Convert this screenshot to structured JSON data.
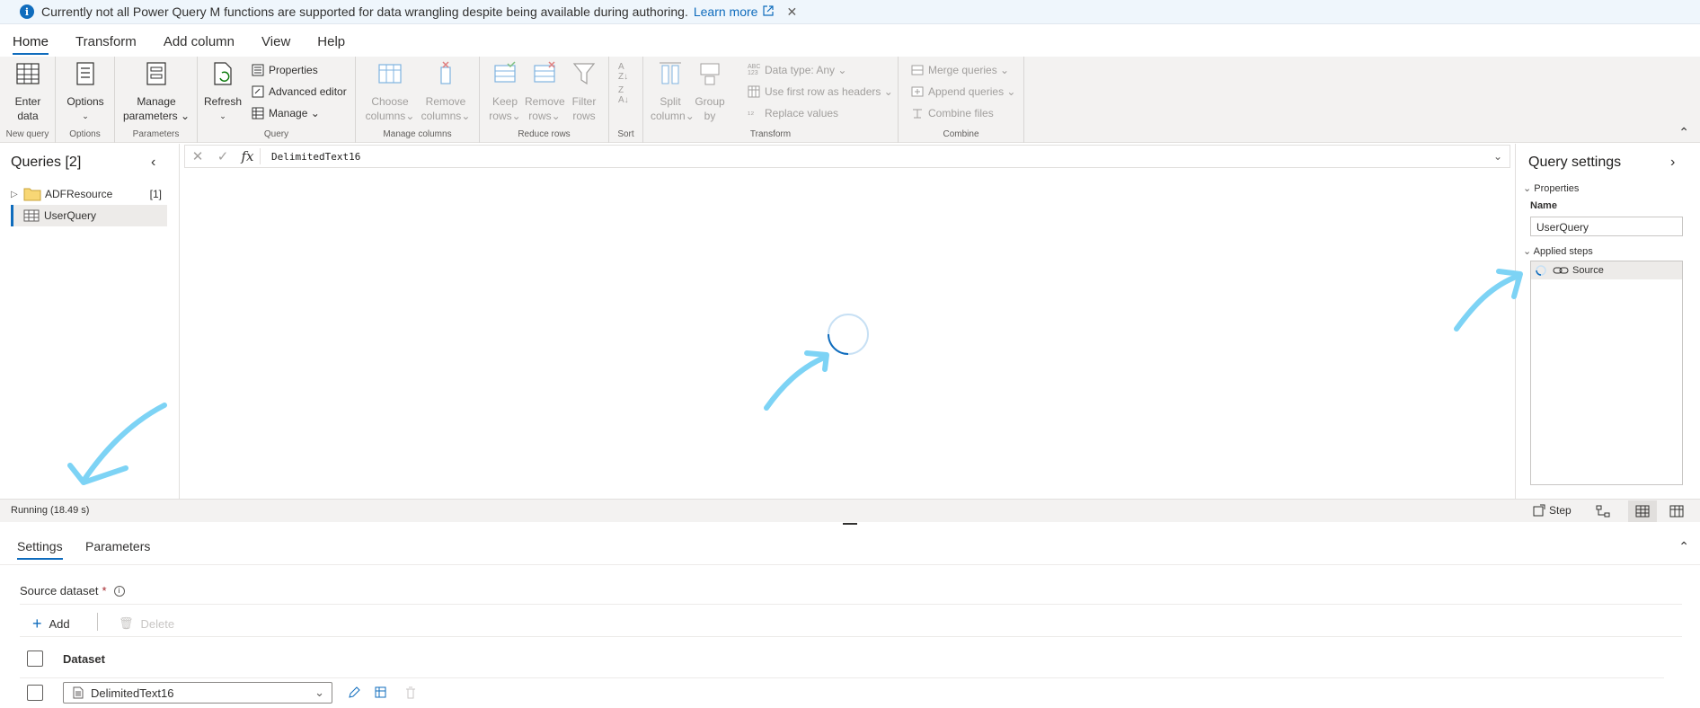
{
  "infobar": {
    "message": "Currently not all Power Query M functions are supported for data wrangling despite being available during authoring.",
    "link": "Learn more"
  },
  "tabs": [
    "Home",
    "Transform",
    "Add column",
    "View",
    "Help"
  ],
  "ribbon": {
    "new_query": {
      "label": "New query",
      "enter_data": [
        "Enter",
        "data"
      ]
    },
    "options": {
      "label": "Options",
      "options_btn": "Options"
    },
    "parameters": {
      "label": "Parameters",
      "manage": [
        "Manage",
        "parameters"
      ]
    },
    "query": {
      "label": "Query",
      "refresh": "Refresh",
      "properties": "Properties",
      "advanced_editor": "Advanced editor",
      "manage": "Manage"
    },
    "manage_columns": {
      "label": "Manage columns",
      "choose": [
        "Choose",
        "columns"
      ],
      "remove": [
        "Remove",
        "columns"
      ]
    },
    "reduce_rows": {
      "label": "Reduce rows",
      "keep": [
        "Keep",
        "rows"
      ],
      "remove": [
        "Remove",
        "rows"
      ],
      "filter": [
        "Filter",
        "rows"
      ]
    },
    "sort": {
      "label": "Sort"
    },
    "transform": {
      "label": "Transform",
      "split": [
        "Split",
        "column"
      ],
      "group": [
        "Group",
        "by"
      ],
      "data_type": "Data type: Any",
      "first_row": "Use first row as headers",
      "replace": "Replace values"
    },
    "combine": {
      "label": "Combine",
      "merge": "Merge queries",
      "append": "Append queries",
      "combine_files": "Combine files"
    }
  },
  "queries": {
    "title": "Queries [2]",
    "items": [
      {
        "name": "ADFResource",
        "count": "[1]"
      },
      {
        "name": "UserQuery"
      }
    ]
  },
  "formula": {
    "text": "DelimitedText16"
  },
  "query_settings": {
    "title": "Query settings",
    "properties": "Properties",
    "name_label": "Name",
    "name_value": "UserQuery",
    "applied_steps": "Applied steps",
    "steps": [
      "Source"
    ]
  },
  "status": {
    "running": "Running (18.49 s)",
    "step": "Step"
  },
  "bottom": {
    "tabs": [
      "Settings",
      "Parameters"
    ],
    "source_dataset_label": "Source dataset",
    "required": "*",
    "add": "Add",
    "delete": "Delete",
    "column_header": "Dataset",
    "row_value": "DelimitedText16"
  },
  "colors": {
    "accent": "#0f6cbd",
    "annotation": "#7dd3f5"
  }
}
